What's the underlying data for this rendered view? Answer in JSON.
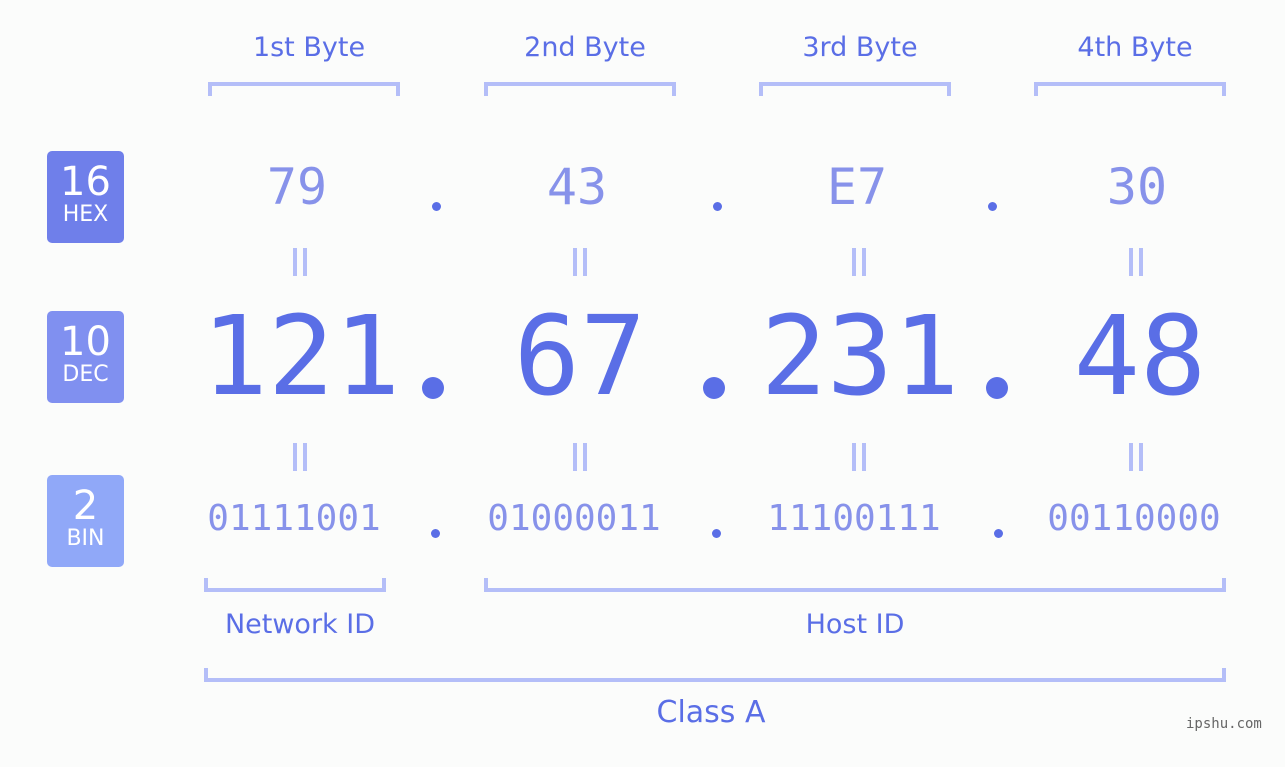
{
  "bytes": [
    {
      "label": "1st Byte",
      "hex": "79",
      "dec": "121",
      "bin": "01111001"
    },
    {
      "label": "2nd Byte",
      "hex": "43",
      "dec": "67",
      "bin": "01000011"
    },
    {
      "label": "3rd Byte",
      "hex": "E7",
      "dec": "231",
      "bin": "11100111"
    },
    {
      "label": "4th Byte",
      "hex": "30",
      "dec": "48",
      "bin": "00110000"
    }
  ],
  "badges": {
    "hex": {
      "num": "16",
      "label": "HEX",
      "color": "#6f7fea"
    },
    "dec": {
      "num": "10",
      "label": "DEC",
      "color": "#8090f0"
    },
    "bin": {
      "num": "2",
      "label": "BIN",
      "color": "#90a8f8"
    }
  },
  "network_label": "Network ID",
  "host_label": "Host ID",
  "class_label": "Class A",
  "watermark": "ipshu.com",
  "colors": {
    "accent": "#5a6ee6",
    "light": "#b4bef8",
    "mid": "#8792ea"
  }
}
